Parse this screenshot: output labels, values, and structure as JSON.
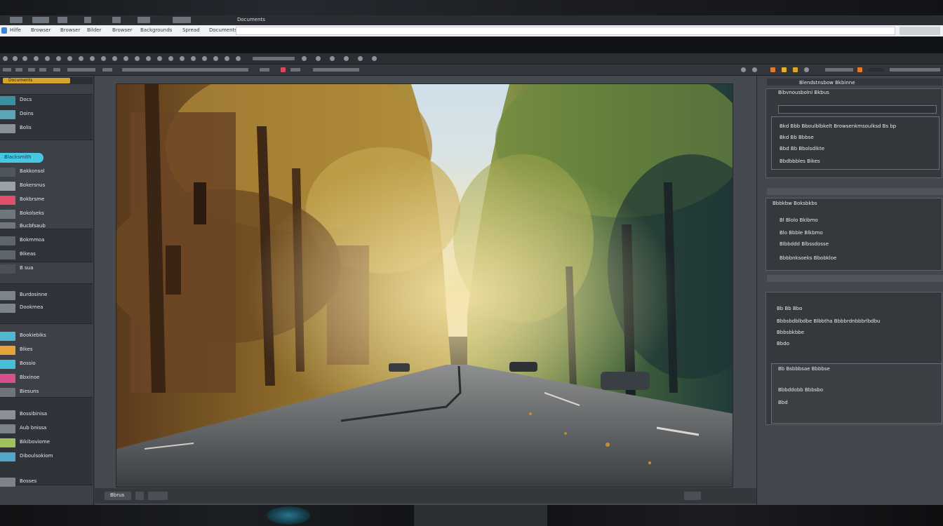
{
  "window": {
    "title": "Documents"
  },
  "menubar": {
    "items": [
      "Hilfe",
      "Browser",
      "Browser",
      "Bilder",
      "Browser",
      "Backgrounds",
      "Spread",
      "Documents"
    ]
  },
  "left_panel": {
    "tab_label": "Documents",
    "pill_label": "Blacksmith",
    "items": [
      {
        "label": "Docs",
        "swatch": "#3a8fa3"
      },
      {
        "label": "Doins",
        "swatch": "#5aa6b8"
      },
      {
        "label": "Bolis",
        "swatch": "#8a9198"
      },
      {
        "label": "Bakkonsol",
        "swatch": "#4f565e"
      },
      {
        "label": "Bokersnus",
        "swatch": "#9aa1a8"
      },
      {
        "label": "Bokbrsme",
        "swatch": "#e0506b"
      },
      {
        "label": "Bokolseks",
        "swatch": "#6f767e"
      },
      {
        "label": "Bucbfsaub",
        "swatch": "#6f767e"
      },
      {
        "label": "Bokmmoa",
        "swatch": "#5e656d"
      },
      {
        "label": "Bikeas",
        "swatch": "#5e656d"
      },
      {
        "label": "B sua",
        "swatch": "#4a5158"
      },
      {
        "label": "Burdosinne",
        "swatch": "#7d848b"
      },
      {
        "label": "Dookmea",
        "swatch": "#7d848b"
      },
      {
        "label": "Bookiebiks",
        "swatch": "#4fb7d0"
      },
      {
        "label": "Bikes",
        "swatch": "#e8a23a"
      },
      {
        "label": "Bossio",
        "swatch": "#45c0d8"
      },
      {
        "label": "Bbxinoe",
        "swatch": "#d84f8b"
      },
      {
        "label": "Biesuns",
        "swatch": "#6d747b"
      },
      {
        "label": "Bossibinisa",
        "swatch": "#8a9198"
      },
      {
        "label": "Aub bnissa",
        "swatch": "#7c8389"
      },
      {
        "label": "Bikiboviome",
        "swatch": "#9fc35a"
      },
      {
        "label": "Diboulsokiom",
        "swatch": "#4fa8c8"
      },
      {
        "label": "Bosses",
        "swatch": "#7c8389"
      }
    ]
  },
  "status": {
    "zoom_label": "Bbrus"
  },
  "right_panel": {
    "header": "Blendstnsbow Bkbinne",
    "section1": {
      "title": "Bibvnousbolni Bkbus",
      "lines": [
        "Bkd Bbb Bboulblbkelt Browsenkmsoulksd Bs bp",
        "Bkd Bb Bbbse",
        "Bbd Bb Bbolsdikte",
        "Bbdbbbles Bikes"
      ]
    },
    "section2": {
      "title": "Bbbkbw Boksbkbs",
      "lines": [
        "Bl Blolo Bkibmo",
        "Blo Bbble Blkbmo",
        "Blbbddd Blbssdosse",
        "Bbbbnksoeks Bbobkloe"
      ]
    },
    "section3": {
      "title": "Bb Bb Bbo",
      "lines": [
        "Bbbsbdblbdbe Blbbtha Bbbbrdnbbbrlbdbu",
        "Bbbsbkbbe",
        "Bbdo",
        "Bb Bsbbbsae Bbbbse",
        "Bbbddobb Bbbsbo",
        "Bbd"
      ]
    }
  },
  "colors": {
    "accent": "#d4a52a",
    "highlight": "#48c7e2",
    "panel": "#3d4147"
  },
  "canvas": {
    "subject": "tree-lined-road-photo"
  }
}
